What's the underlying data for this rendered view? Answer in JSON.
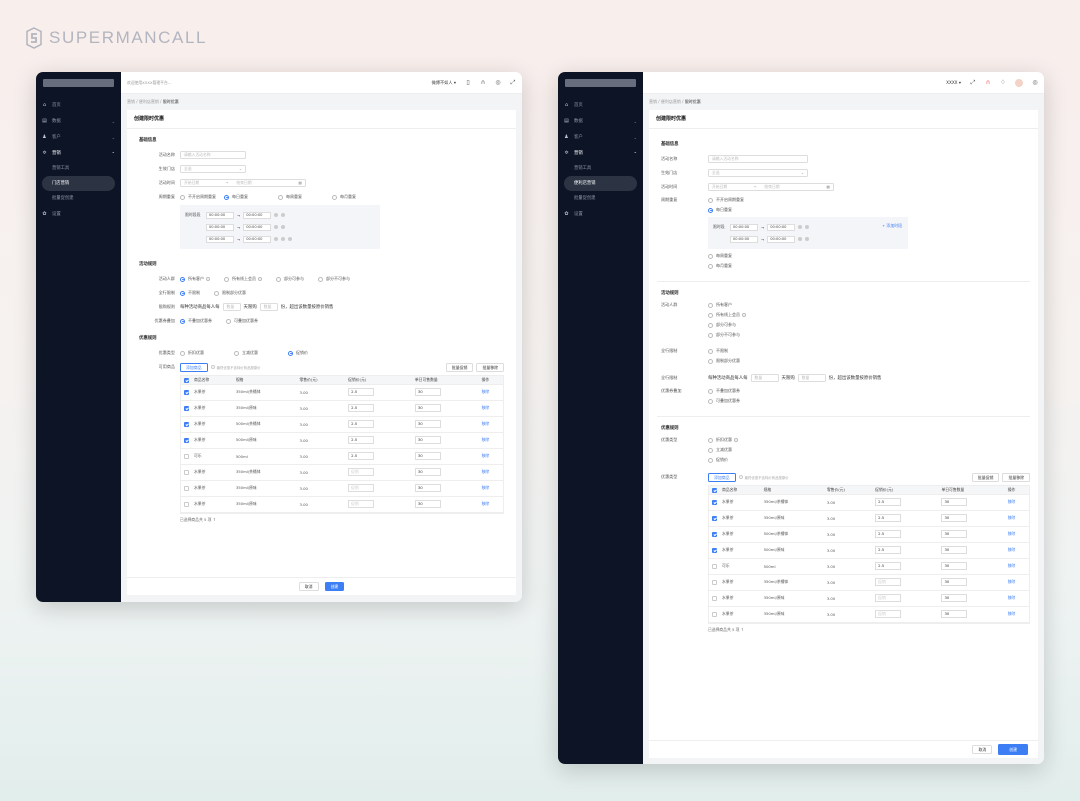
{
  "brand": {
    "name": "SUPERMANCALL"
  },
  "sidebar": {
    "items": [
      {
        "icon": "home-icon",
        "label": "首页"
      },
      {
        "icon": "data-icon",
        "label": "数据"
      },
      {
        "icon": "customer-icon",
        "label": "客户"
      },
      {
        "icon": "marketing-icon",
        "label": "营销"
      },
      {
        "icon": "settings-icon",
        "label": "设置"
      }
    ],
    "sub1": [
      "营销工具",
      "门店营销",
      "批量促创建"
    ],
    "sub2": [
      "营销工具",
      "便利店营销",
      "批量促创建"
    ]
  },
  "topbar": {
    "placeholder": "欢迎使用XXXX管理平台...",
    "user1": "微博不如人",
    "user2": "XXXX"
  },
  "breadcrumb": {
    "a": "营销",
    "b1": "便利店营销",
    "b2": "便利店营销",
    "c": "限时优惠"
  },
  "form": {
    "title1": "创建限时优惠",
    "title2": "创建限时优惠",
    "basic": "基础信息",
    "name_label": "活动名称",
    "name_ph": "请输入活动名称",
    "store_label": "生效门店",
    "store_val": "全选",
    "time_label": "活动时间",
    "start_ph": "开始日期",
    "end_ph": "结束日期",
    "to": "→",
    "repeat_label": "周期重复",
    "repeat_opts": [
      "不开启周期重复",
      "每日重复",
      "每周重复",
      "每月重复"
    ],
    "period_label": "限时段",
    "period_label1": "限时段段",
    "add_period": "+ 添加时段",
    "t0": "00:00:00",
    "rules": "活动规则",
    "people_label": "活动人群",
    "people_opts": [
      "所有客户",
      "所有线上会员",
      "部分可参与",
      "部分不可参与"
    ],
    "limit_label": "全行限制",
    "limit_opts": [
      "不限制",
      "限制部分优惠"
    ],
    "buy_label": "限购规则",
    "buy_label2": "全行限制",
    "buy_text1": "每种活动商品每人每",
    "buy_ph1": "数量",
    "buy_text2": "天限购",
    "buy_ph2": "数量",
    "buy_text3": "份，超出该数量按原价销售",
    "stack_label": "优惠券叠加",
    "stack_label2": "优惠券叠加",
    "stack_opts": [
      "不叠加优惠券",
      "可叠加优惠券"
    ],
    "discount": "优惠规则",
    "dtype_label": "优惠类型",
    "dtype_opts": [
      "折扣优惠",
      "立减优惠",
      "促销价"
    ],
    "goods_label": "可用商品",
    "goods_label2": "优惠类型",
    "add_goods": "添加商品",
    "goods_hint": "最终优惠不含特价商品按原价",
    "batch_price": "批量促销",
    "batch_remove": "批量移除",
    "selected": "已选择商品共 5 项",
    "cancel": "取消",
    "create": "创建"
  },
  "table": {
    "headers": [
      "商品名称",
      "规格",
      "零售价(元)",
      "促销价(元)",
      "单日可售数量",
      "操作"
    ],
    "rows": [
      {
        "checked": true,
        "name": "水果茶",
        "spec": "350ml/茶桶钵",
        "price": "3.00",
        "promo": "2.5",
        "qty": "30",
        "op": "移除"
      },
      {
        "checked": true,
        "name": "水果茶",
        "spec": "350ml/原味",
        "price": "3.00",
        "promo": "2.5",
        "qty": "30",
        "op": "移除"
      },
      {
        "checked": true,
        "name": "水果茶",
        "spec": "500ml/茶桶钵",
        "price": "3.00",
        "promo": "2.5",
        "qty": "30",
        "op": "移除"
      },
      {
        "checked": true,
        "name": "水果茶",
        "spec": "500ml/原味",
        "price": "3.00",
        "promo": "2.5",
        "qty": "30",
        "op": "移除"
      },
      {
        "checked": false,
        "name": "可乐",
        "spec": "500ml",
        "price": "3.00",
        "promo": "2.5",
        "qty": "30",
        "op": "移除"
      },
      {
        "checked": false,
        "name": "水果茶",
        "spec": "350ml/茶桶钵",
        "price": "3.00",
        "promo": "促销",
        "qty": "30",
        "op": "移除"
      },
      {
        "checked": false,
        "name": "水果茶",
        "spec": "350ml/原味",
        "price": "3.00",
        "promo": "促销",
        "qty": "30",
        "op": "移除"
      },
      {
        "checked": false,
        "name": "水果茶",
        "spec": "350ml/原味",
        "price": "3.00",
        "promo": "促销",
        "qty": "30",
        "op": "移除"
      }
    ]
  },
  "colors": {
    "sidebar": "#0d1426",
    "accent": "#3d7ef5"
  }
}
